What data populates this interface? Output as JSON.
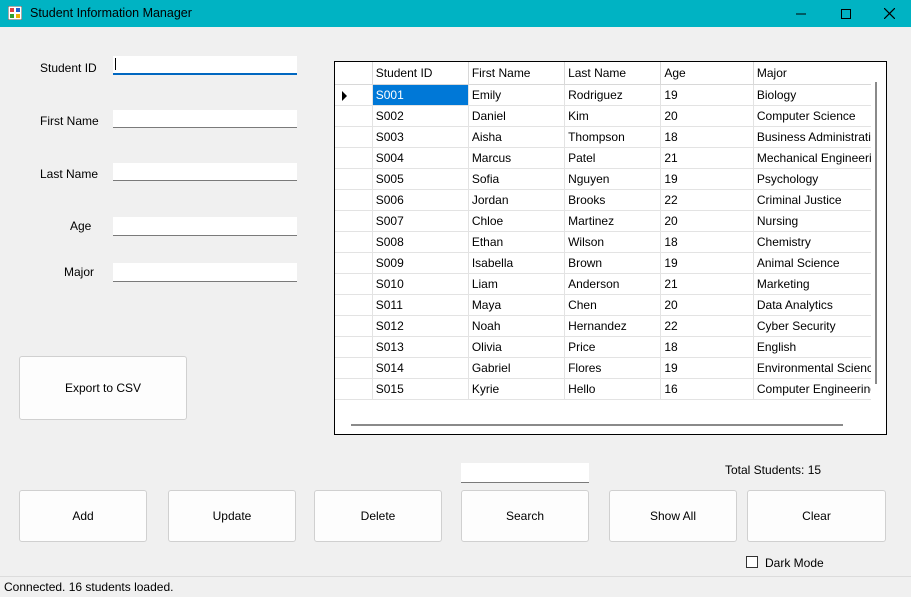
{
  "window": {
    "title": "Student Information Manager"
  },
  "form": {
    "student_id_label": "Student ID",
    "first_name_label": "First Name",
    "last_name_label": "Last Name",
    "age_label": "Age",
    "major_label": "Major",
    "student_id_value": "",
    "first_name_value": "",
    "last_name_value": "",
    "age_value": "",
    "major_value": ""
  },
  "buttons": {
    "export_csv": "Export to CSV",
    "add": "Add",
    "update": "Update",
    "delete": "Delete",
    "search": "Search",
    "show_all": "Show All",
    "clear": "Clear"
  },
  "search_value": "",
  "total_students": "Total Students: 15",
  "dark_mode_label": "Dark Mode",
  "status_text": "Connected. 16 students loaded.",
  "grid": {
    "columns": [
      "Student ID",
      "First Name",
      "Last Name",
      "Age",
      "Major"
    ],
    "rows": [
      [
        "S001",
        "Emily",
        "Rodriguez",
        "19",
        "Biology"
      ],
      [
        "S002",
        "Daniel",
        "Kim",
        "20",
        "Computer Science"
      ],
      [
        "S003",
        "Aisha",
        "Thompson",
        "18",
        "Business Administration"
      ],
      [
        "S004",
        "Marcus",
        "Patel",
        "21",
        "Mechanical Engineering"
      ],
      [
        "S005",
        "Sofia",
        "Nguyen",
        "19",
        "Psychology"
      ],
      [
        "S006",
        "Jordan",
        "Brooks",
        "22",
        "Criminal Justice"
      ],
      [
        "S007",
        "Chloe",
        "Martinez",
        "20",
        "Nursing"
      ],
      [
        "S008",
        "Ethan",
        "Wilson",
        "18",
        "Chemistry"
      ],
      [
        "S009",
        "Isabella",
        "Brown",
        "19",
        "Animal Science"
      ],
      [
        "S010",
        "Liam",
        "Anderson",
        "21",
        "Marketing"
      ],
      [
        "S011",
        "Maya",
        "Chen",
        "20",
        "Data Analytics"
      ],
      [
        "S012",
        "Noah",
        "Hernandez",
        "22",
        "Cyber Security"
      ],
      [
        "S013",
        "Olivia",
        "Price",
        "18",
        "English"
      ],
      [
        "S014",
        "Gabriel",
        "Flores",
        "19",
        "Environmental Science"
      ],
      [
        "S015",
        "Kyrie",
        "Hello",
        "16",
        "Computer Engineering"
      ]
    ],
    "selected_row": 0
  },
  "colors": {
    "titlebar": "#00b3c3",
    "selection": "#0078d7"
  }
}
